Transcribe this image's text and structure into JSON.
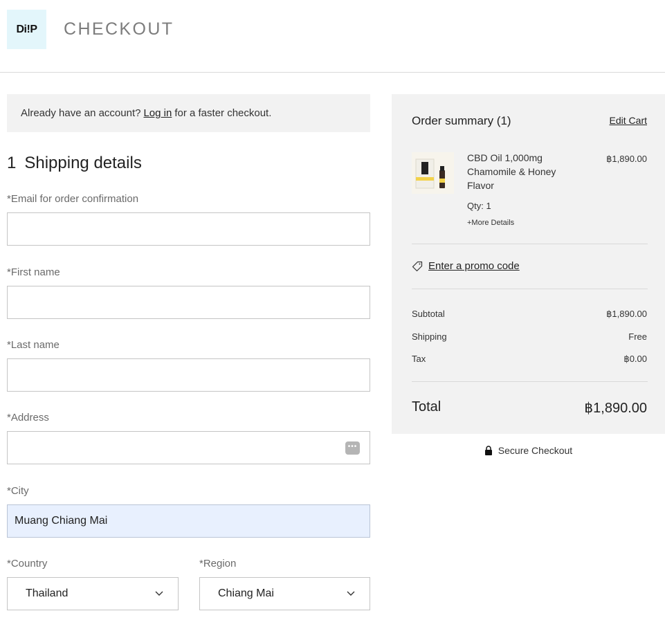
{
  "header": {
    "logo_text": "Di!P",
    "title": "CHECKOUT"
  },
  "login_banner": {
    "prefix": "Already have an account?",
    "link": "Log in",
    "suffix": "for a faster checkout."
  },
  "shipping": {
    "step_number": "1",
    "title": "Shipping details",
    "fields": {
      "email": {
        "label": "*Email for order confirmation",
        "value": ""
      },
      "first_name": {
        "label": "*First name",
        "value": ""
      },
      "last_name": {
        "label": "*Last name",
        "value": ""
      },
      "address": {
        "label": "*Address",
        "value": "",
        "autofill_icon": "password-dots-icon"
      },
      "city": {
        "label": "*City",
        "value": "Muang Chiang Mai"
      },
      "country": {
        "label": "*Country",
        "value": "Thailand"
      },
      "region": {
        "label": "*Region",
        "value": "Chiang Mai"
      }
    }
  },
  "summary": {
    "title": "Order summary (1)",
    "edit_cart": "Edit Cart",
    "item": {
      "name": "CBD Oil 1,000mg Chamomile & Honey Flavor",
      "price": "฿1,890.00",
      "qty": "Qty: 1",
      "more": "+More Details"
    },
    "promo": "Enter a promo code",
    "subtotal_label": "Subtotal",
    "subtotal_value": "฿1,890.00",
    "shipping_label": "Shipping",
    "shipping_value": "Free",
    "tax_label": "Tax",
    "tax_value": "฿0.00",
    "total_label": "Total",
    "total_value": "฿1,890.00"
  },
  "secure_checkout": "Secure Checkout",
  "colors": {
    "summary_bg": "#f2f2f2",
    "logo_bg": "#e3f6fb",
    "autofill_bg": "#e8f0fe"
  }
}
